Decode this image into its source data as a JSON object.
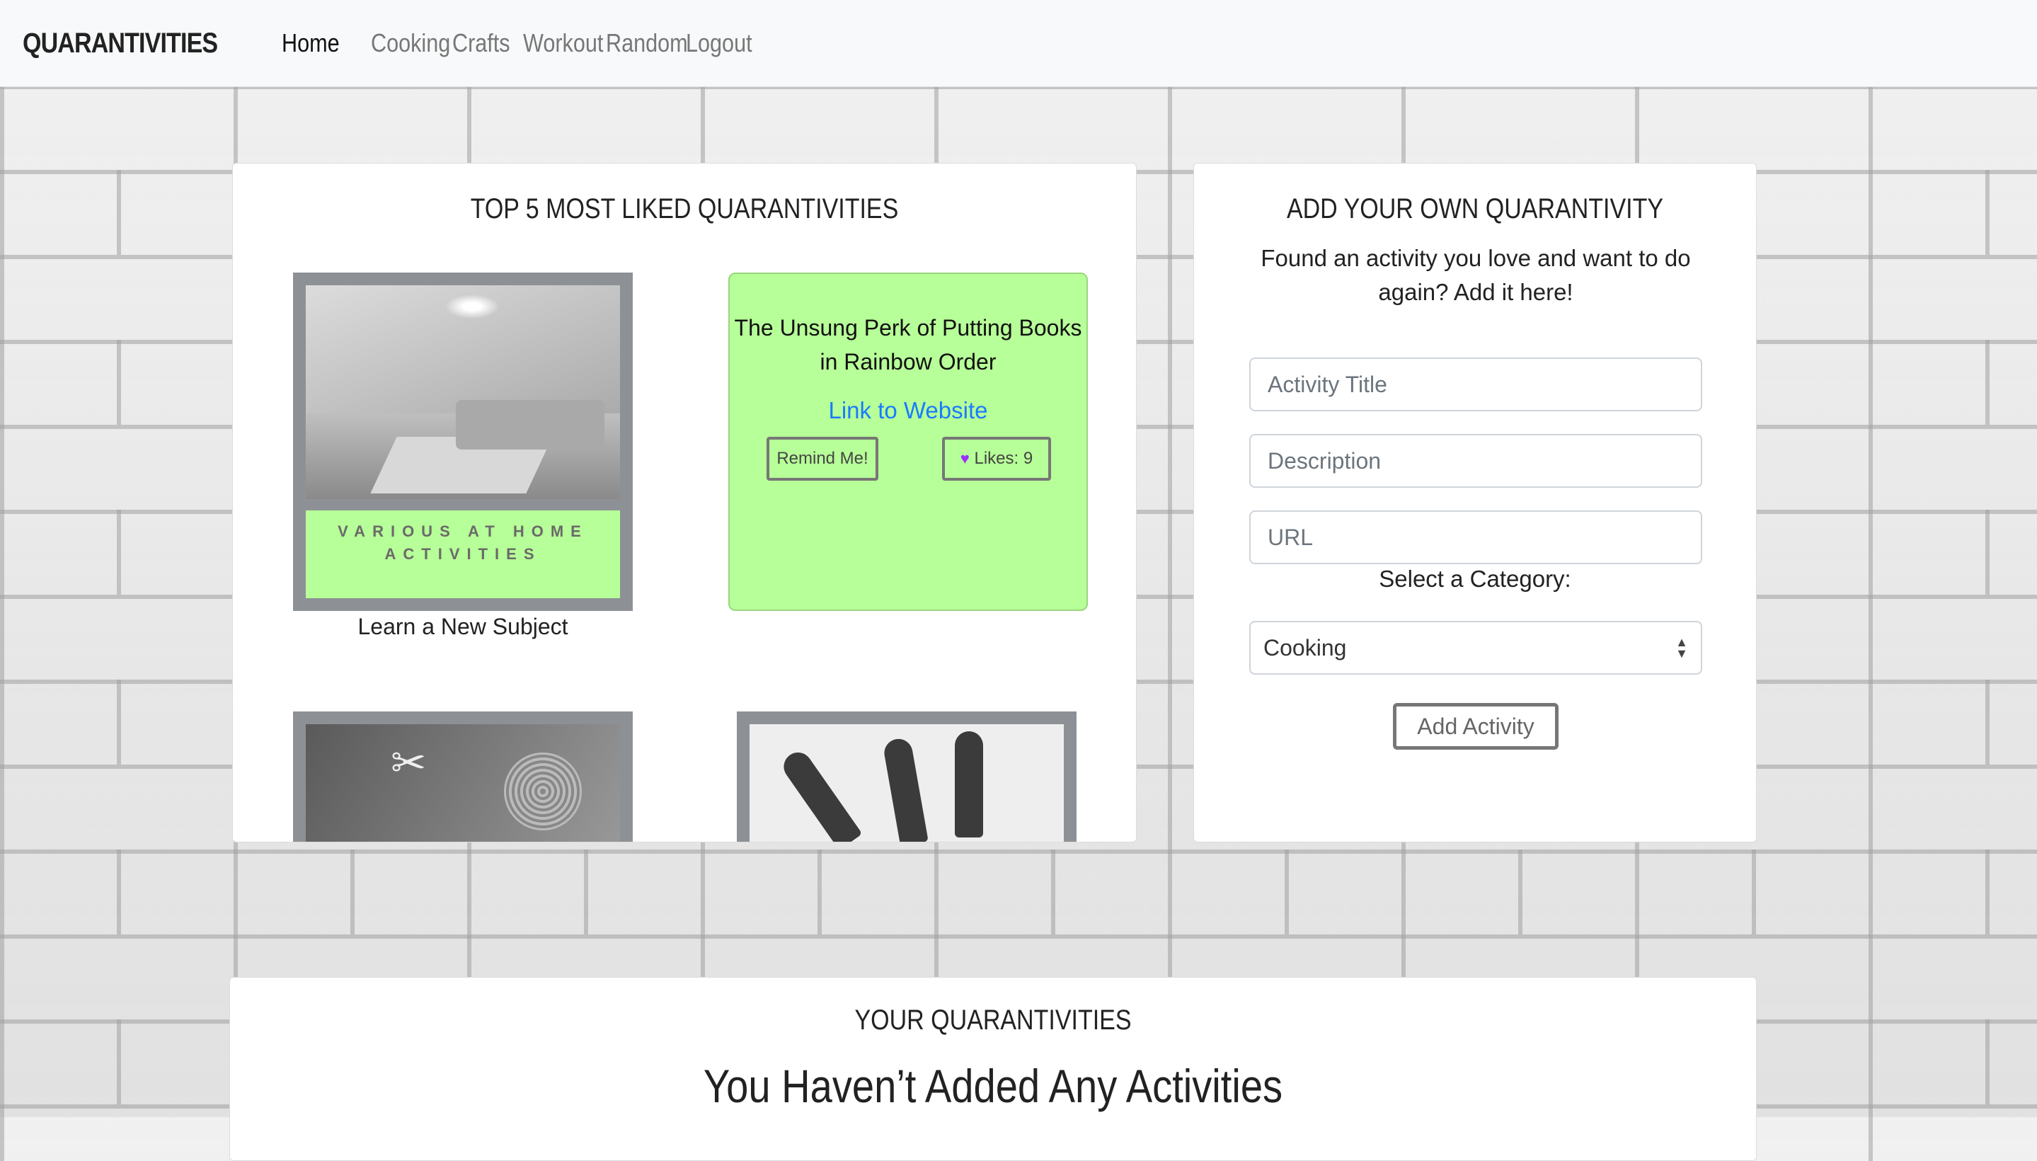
{
  "navbar": {
    "brand": "QUARANTIVITIES",
    "links": [
      "Home",
      "Cooking",
      "Crafts",
      "Workout",
      "Random",
      "Logout"
    ]
  },
  "top5": {
    "title": "TOP 5 MOST LIKED QUARANTIVITIES",
    "tile1": {
      "banner": "VARIOUS AT HOME ACTIVITIES",
      "caption": "Learn a New Subject"
    },
    "tile2": {
      "title": "The Unsung Perk of Putting Books in Rainbow Order",
      "link": "Link to Website",
      "remind": "Remind Me!",
      "likes": "Likes: 9"
    }
  },
  "add_form": {
    "title": "ADD YOUR OWN QUARANTIVITY",
    "description": "Found an activity you love and want to do again? Add it here!",
    "title_placeholder": "Activity Title",
    "desc_placeholder": "Description",
    "url_placeholder": "URL",
    "category_label": "Select a Category:",
    "category_value": "Cooking",
    "submit": "Add Activity"
  },
  "yours": {
    "title": "YOUR QUARANTIVITIES",
    "empty": "You Haven’t Added Any Activities"
  },
  "colors": {
    "accent_green": "#b7ff98",
    "link_blue": "#1a7bff",
    "tile_gray": "#8d9196"
  }
}
